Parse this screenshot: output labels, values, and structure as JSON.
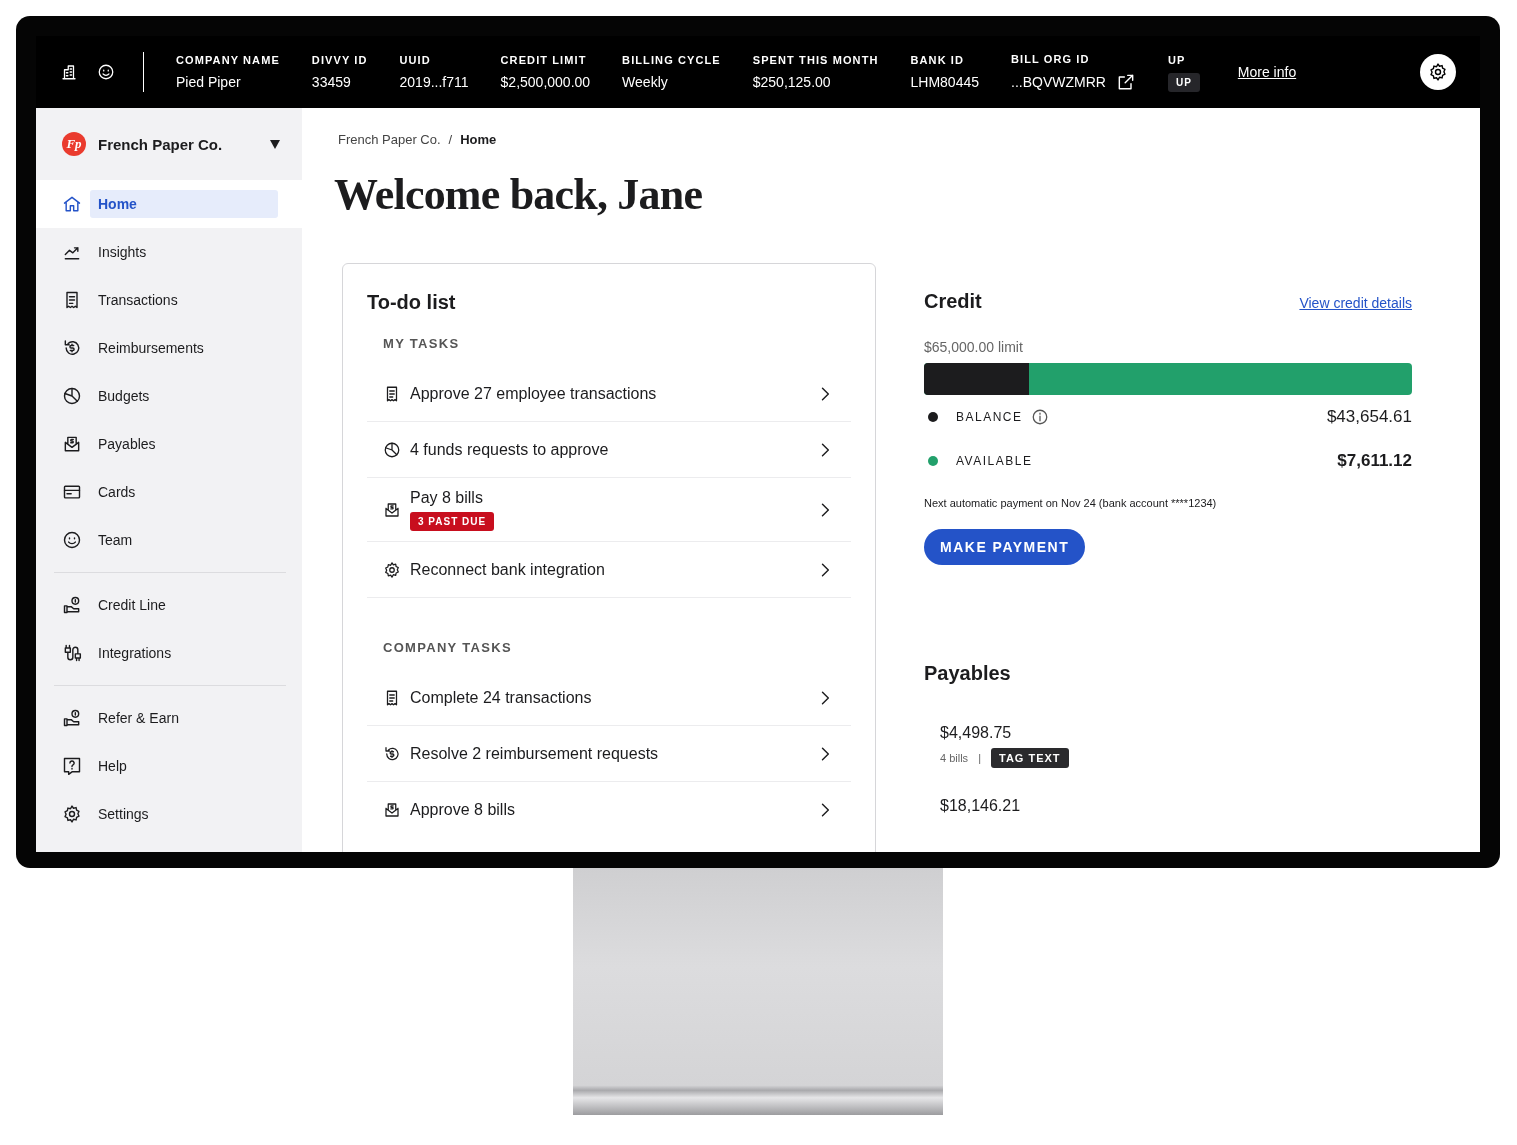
{
  "topbar": {
    "fields": [
      {
        "label": "COMPANY NAME",
        "value": "Pied Piper",
        "kind": "text"
      },
      {
        "label": "DIVVY ID",
        "value": "33459",
        "kind": "text"
      },
      {
        "label": "UUID",
        "value": "2019...f711",
        "kind": "text"
      },
      {
        "label": "CREDIT LIMIT",
        "value": "$2,500,000.00",
        "kind": "text"
      },
      {
        "label": "BILLING CYCLE",
        "value": "Weekly",
        "kind": "text"
      },
      {
        "label": "SPENT THIS MONTH",
        "value": "$250,125.00",
        "kind": "text"
      },
      {
        "label": "BANK ID",
        "value": "LHM80445",
        "kind": "text"
      },
      {
        "label": "BILL ORG ID",
        "value": "...BQVWZMRR",
        "kind": "link"
      },
      {
        "label": "UP",
        "value": "UP",
        "kind": "tag"
      }
    ],
    "more_info": "More info"
  },
  "sidebar": {
    "company": "French Paper Co.",
    "logo": "Fp",
    "groups": [
      [
        {
          "label": "Home",
          "selected": true
        },
        {
          "label": "Insights",
          "selected": false
        },
        {
          "label": "Transactions",
          "selected": false
        },
        {
          "label": "Reimbursements",
          "selected": false
        },
        {
          "label": "Budgets",
          "selected": false
        },
        {
          "label": "Payables",
          "selected": false
        },
        {
          "label": "Cards",
          "selected": false
        },
        {
          "label": "Team",
          "selected": false
        }
      ],
      [
        {
          "label": "Credit Line",
          "selected": false
        },
        {
          "label": "Integrations",
          "selected": false
        }
      ],
      [
        {
          "label": "Refer & Earn",
          "selected": false
        },
        {
          "label": "Help",
          "selected": false
        },
        {
          "label": "Settings",
          "selected": false
        }
      ]
    ]
  },
  "breadcrumb": {
    "items": [
      "French Paper Co.",
      "Home"
    ],
    "separator": "/"
  },
  "heading": "Welcome back, Jane",
  "todo": {
    "title": "To-do list",
    "sections": [
      {
        "heading": "MY TASKS",
        "items": [
          {
            "label": "Approve 27 employee transactions"
          },
          {
            "label": "4 funds requests to approve"
          },
          {
            "label": "Pay 8 bills",
            "badge": "3 PAST DUE"
          },
          {
            "label": "Reconnect bank integration"
          }
        ]
      },
      {
        "heading": "COMPANY TASKS",
        "items": [
          {
            "label": "Complete 24 transactions"
          },
          {
            "label": "Resolve 2 reimbursement requests"
          },
          {
            "label": "Approve 8 bills"
          }
        ]
      }
    ]
  },
  "credit": {
    "title": "Credit",
    "link": "View credit details",
    "limit": "$65,000.00 limit",
    "level": 0.215,
    "legend": [
      {
        "label": "BALANCE",
        "value": "$43,654.61",
        "color": "#1c1c1e",
        "info": true,
        "strong": false
      },
      {
        "label": "AVAILABLE",
        "value": "$7,611.12",
        "color": "#22a06b",
        "info": false,
        "strong": true
      }
    ],
    "note": "Next automatic payment on Nov 24 (bank account ****1234)",
    "button": "MAKE PAYMENT"
  },
  "payables": {
    "title": "Payables",
    "items": [
      {
        "amount": "$4,498.75",
        "count": "4 bills",
        "separator": "|",
        "tag": "TAG TEXT"
      },
      {
        "amount": "$18,146.21"
      }
    ]
  }
}
